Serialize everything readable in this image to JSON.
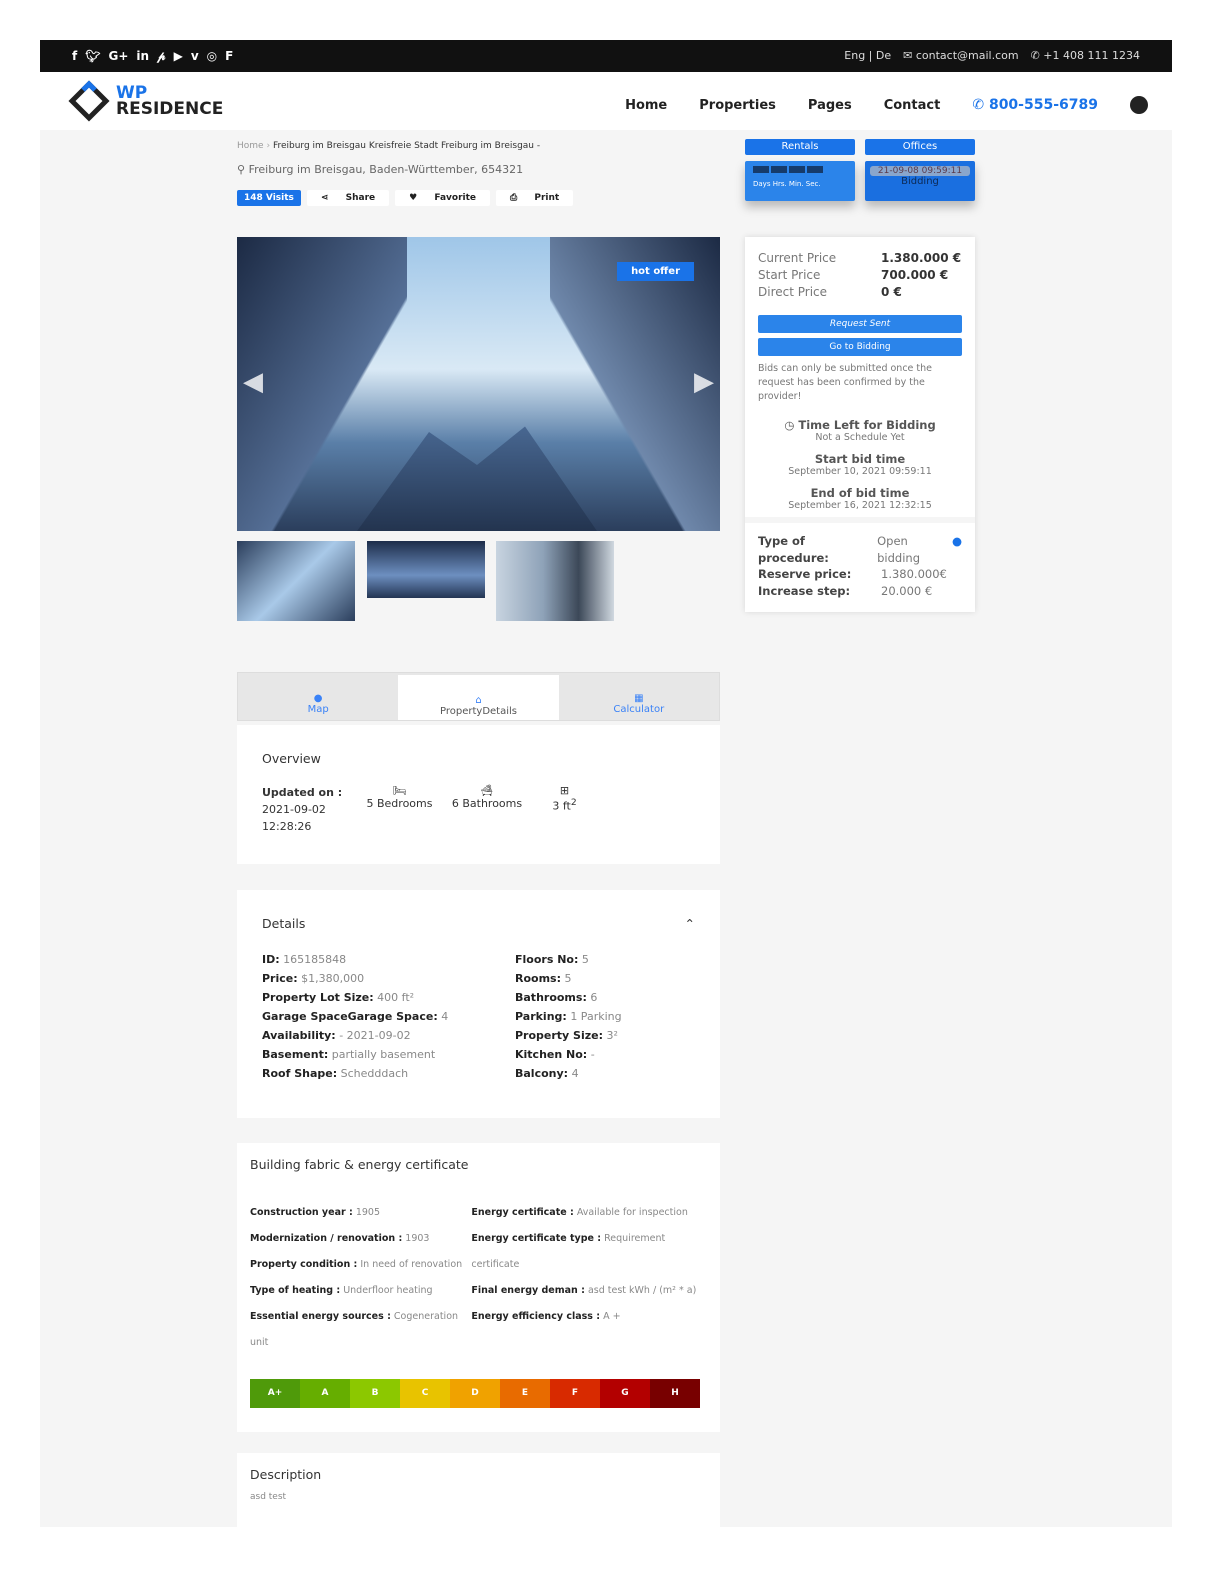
{
  "topbar": {
    "social_icons": [
      "facebook-icon",
      "twitter-icon",
      "google-plus-icon",
      "linkedin-icon",
      "pinterest-icon",
      "youtube-icon",
      "vimeo-icon",
      "instagram-icon",
      "foursquare-icon"
    ],
    "lang": "Eng  | De",
    "email": "contact@mail.com",
    "phone": "+1 408 111 1234"
  },
  "header": {
    "logo_top": "WP",
    "logo_bottom": "RESIDENCE",
    "nav": [
      "Home",
      "Properties",
      "Pages",
      "Contact"
    ],
    "phone": "800-555-6789"
  },
  "breadcrumb": {
    "home": "Home",
    "current": "Freiburg im Breisgau Kreisfreie Stadt Freiburg im Breisgau -"
  },
  "address": "Freiburg im Breisgau, Baden-Württember, 654321",
  "actions": {
    "visits": "148 Visits",
    "share": "Share",
    "favorite": "Favorite",
    "print": "Print"
  },
  "gallery": {
    "badge": "hot offer"
  },
  "side_tabs": {
    "rentals": "Rentals",
    "countdown_label": "Days Hrs. Min. Sec.",
    "offices": "Offices",
    "date": "21-09-08 09:59:11",
    "status": "Bidding"
  },
  "pricing": {
    "rows": [
      {
        "label": "Current Price",
        "value": "1.380.000 €"
      },
      {
        "label": "Start Price",
        "value": "700.000 €"
      },
      {
        "label": "Direct Price",
        "value": "0 €"
      }
    ],
    "request_btn": "Request Sent",
    "bidding_btn": "Go to Bidding",
    "note": "Bids can only be submitted once the request has been confirmed by the provider!",
    "time_left_title": "Time Left for Bidding",
    "time_left_value": "Not a Schedule Yet",
    "start_title": "Start bid time",
    "start_value": "September 10, 2021 09:59:11",
    "end_title": "End of bid time",
    "end_value": "September 16, 2021 12:32:15",
    "procedure": [
      {
        "label": "Type of procedure:",
        "value": "Open bidding"
      },
      {
        "label": "Reserve price:",
        "value": "1.380.000€"
      },
      {
        "label": "Increase step:",
        "value": "20.000 €"
      }
    ]
  },
  "tabs": [
    "Map",
    "PropertyDetails",
    "Calculator"
  ],
  "overview": {
    "title": "Overview",
    "updated_label": "Updated on :",
    "updated_date": "2021-09-02",
    "updated_time": "12:28:26",
    "bedrooms": "5 Bedrooms",
    "bathrooms": "6 Bathrooms",
    "size": "3 ft",
    "size_sup": "2"
  },
  "details": {
    "title": "Details",
    "left": [
      {
        "l": "ID:",
        "v": "165185848"
      },
      {
        "l": "Price:",
        "v": "$1,380,000"
      },
      {
        "l": "Property Lot Size:",
        "v": "400 ft²"
      },
      {
        "l": "Garage SpaceGarage Space:",
        "v": "4"
      },
      {
        "l": "Availability:",
        "v": "- 2021-09-02"
      },
      {
        "l": "Basement:",
        "v": "partially basement"
      },
      {
        "l": "Roof Shape:",
        "v": "Schedddach"
      }
    ],
    "right": [
      {
        "l": "Floors No:",
        "v": "5"
      },
      {
        "l": "Rooms:",
        "v": "5"
      },
      {
        "l": "Bathrooms:",
        "v": "6"
      },
      {
        "l": "Parking:",
        "v": "1 Parking"
      },
      {
        "l": "Property Size:",
        "v": "3²"
      },
      {
        "l": "Kitchen No:",
        "v": "-"
      },
      {
        "l": "Balcony:",
        "v": "4"
      }
    ]
  },
  "energy": {
    "title": "Building fabric & energy certificate",
    "left": [
      {
        "l": "Construction year :",
        "v": "1905"
      },
      {
        "l": "Modernization / renovation :",
        "v": "1903"
      },
      {
        "l": "Property condition :",
        "v": "In need of renovation"
      },
      {
        "l": "Type of heating :",
        "v": "Underfloor heating"
      },
      {
        "l": "Essential energy sources :",
        "v": "Cogeneration unit"
      }
    ],
    "right": [
      {
        "l": "Energy certificate :",
        "v": "Available for inspection"
      },
      {
        "l": "Energy certificate type :",
        "v": "Requirement certificate"
      },
      {
        "l": "Final energy deman :",
        "v": "asd test kWh / (m² * a)"
      },
      {
        "l": "Energy efficiency class :",
        "v": "A +"
      }
    ],
    "classes": [
      {
        "k": "A+",
        "c": "#4f9a0a"
      },
      {
        "k": "A",
        "c": "#66ae00"
      },
      {
        "k": "B",
        "c": "#8cc800"
      },
      {
        "k": "C",
        "c": "#e8c300"
      },
      {
        "k": "D",
        "c": "#f0a200"
      },
      {
        "k": "E",
        "c": "#e86b00"
      },
      {
        "k": "F",
        "c": "#d82a00"
      },
      {
        "k": "G",
        "c": "#b30000"
      },
      {
        "k": "H",
        "c": "#780000"
      }
    ]
  },
  "description": {
    "title": "Description",
    "text": "asd test"
  }
}
